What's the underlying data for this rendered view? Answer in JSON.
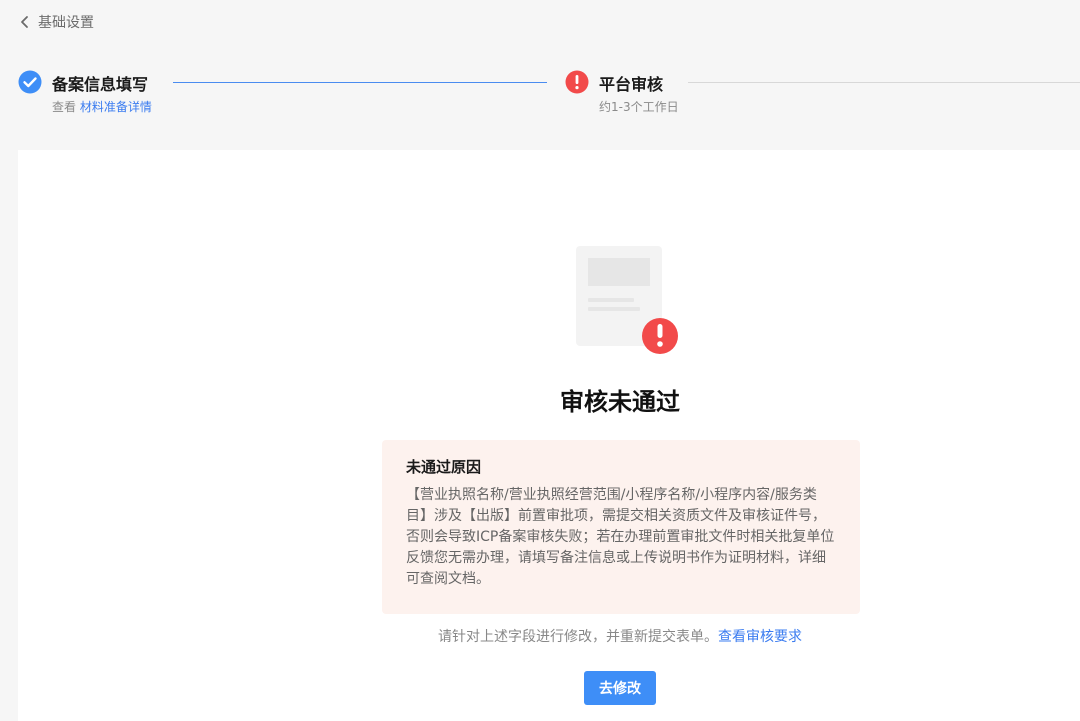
{
  "nav": {
    "back_label": "基础设置"
  },
  "steps": [
    {
      "title": "备案信息填写",
      "sub_prefix": "查看",
      "sub_link": "材料准备详情",
      "status": "done"
    },
    {
      "title": "平台审核",
      "sub": "约1-3个工作日",
      "status": "error"
    }
  ],
  "result": {
    "title": "审核未通过",
    "reason_title": "未通过原因",
    "reason_text": "【营业执照名称/营业执照经营范围/小程序名称/小程序内容/服务类目】涉及【出版】前置审批项，需提交相关资质文件及审核证件号，否则会导致ICP备案审核失败；若在办理前置审批文件时相关批复单位反馈您无需办理，请填写备注信息或上传说明书作为证明材料，详细可查阅文档。",
    "hint_text": "请针对上述字段进行修改，并重新提交表单。",
    "hint_link": "查看审核要求",
    "button_label": "去修改"
  },
  "colors": {
    "accent": "#3e8ef7",
    "link": "#3b7cf0",
    "error": "#f24a4a",
    "reason_bg": "#fdf2ee",
    "page_bg": "#f6f6f6"
  },
  "icons": {
    "back": "chevron-left-icon",
    "step_done": "check-circle-icon",
    "step_error": "exclamation-circle-icon",
    "illustration": "document-error-icon"
  }
}
